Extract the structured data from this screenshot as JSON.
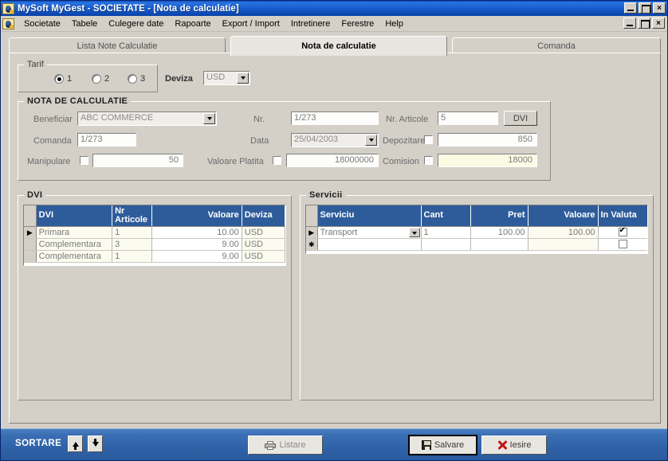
{
  "window": {
    "title": "MySoft MyGest  - SOCIETATE - [Nota de calculatie]",
    "app_icon": "mygest-app-icon",
    "controls": {
      "minimize": "_",
      "maximize": "□",
      "close": "×"
    }
  },
  "menu": {
    "items": [
      {
        "label": "Societate"
      },
      {
        "label": "Tabele"
      },
      {
        "label": "Culegere date"
      },
      {
        "label": "Rapoarte"
      },
      {
        "label": "Export / Import"
      },
      {
        "label": "Intretinere"
      },
      {
        "label": "Ferestre"
      },
      {
        "label": "Help"
      }
    ]
  },
  "tabs": [
    {
      "label": "Lista Note Calculatie",
      "active": false
    },
    {
      "label": "Nota de calculatie",
      "active": true
    },
    {
      "label": "Comanda",
      "active": false
    }
  ],
  "tarif": {
    "title": "Tarif",
    "options": [
      {
        "label": "1",
        "selected": true
      },
      {
        "label": "2",
        "selected": false
      },
      {
        "label": "3",
        "selected": false
      }
    ]
  },
  "deviza": {
    "label": "Deviza",
    "value": "USD"
  },
  "nota": {
    "title": "NOTA DE CALCULATIE",
    "beneficiar": {
      "label": "Beneficiar",
      "value": "ABC COMMERCE"
    },
    "comanda": {
      "label": "Comanda",
      "value": "1/273"
    },
    "manipulare": {
      "label": "Manipulare",
      "checked": false,
      "value": "50"
    },
    "nr": {
      "label": "Nr.",
      "value": "1/273"
    },
    "data": {
      "label": "Data",
      "value": "25/04/2003"
    },
    "valoare_platita": {
      "label": "Valoare Platita",
      "checked": false,
      "value": "18000000"
    },
    "nr_articole": {
      "label": "Nr. Articole",
      "value": "5"
    },
    "dvi_button": {
      "label": "DVI"
    },
    "depozitare": {
      "label": "Depozitare",
      "checked": false,
      "value": "850"
    },
    "comision": {
      "label": "Comision",
      "checked": false,
      "value": "18000"
    }
  },
  "dvi_grid": {
    "title": "DVI",
    "columns": [
      "DVI",
      "Nr\nArticole",
      "Valoare",
      "Deviza"
    ],
    "columns_flat": [
      "DVI",
      "Nr Articole",
      "Valoare",
      "Deviza"
    ],
    "rows": [
      {
        "marker": "▶",
        "dvi": "Primara",
        "nr_articole": "1",
        "valoare": "10.00",
        "deviza": "USD"
      },
      {
        "marker": "",
        "dvi": "Complementara",
        "nr_articole": "3",
        "valoare": "9.00",
        "deviza": "USD"
      },
      {
        "marker": "",
        "dvi": "Complementara",
        "nr_articole": "1",
        "valoare": "9.00",
        "deviza": "USD"
      }
    ]
  },
  "servicii_grid": {
    "title": "Servicii",
    "columns": [
      "Serviciu",
      "Cant",
      "Pret",
      "Valoare",
      "In Valuta"
    ],
    "rows": [
      {
        "marker": "▶",
        "serviciu": "Transport",
        "cant": "1",
        "pret": "100.00",
        "valoare": "100.00",
        "in_valuta": true
      },
      {
        "marker": "✱",
        "serviciu": "",
        "cant": "",
        "pret": "",
        "valoare": "",
        "in_valuta": false
      }
    ]
  },
  "actionbar": {
    "sortare_label": "SORTARE",
    "sort_up": "▲",
    "sort_down": "▼",
    "listare": "Listare",
    "salvare": "Salvare",
    "iesire": "Iesire"
  }
}
